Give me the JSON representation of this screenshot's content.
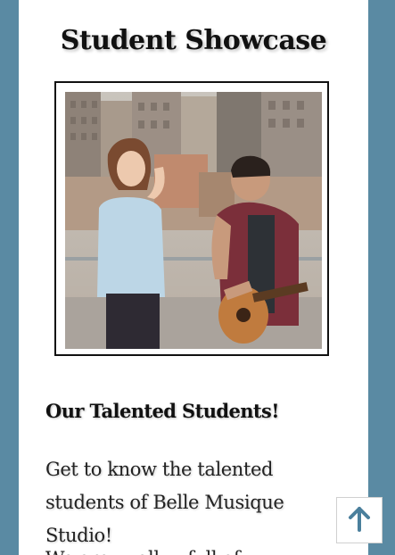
{
  "showcase": {
    "title": "Student Showcase",
    "photo_alt": "Two students performing on a rooftop, one singing and one playing acoustic guitar",
    "subheading": "Our Talented Students!",
    "intro": "Get to know the talented students of Belle Musique Studio!",
    "next_text": "We are ... all ... full of"
  },
  "controls": {
    "back_to_top_icon": "arrow-up-icon"
  },
  "colors": {
    "background": "#5a8aa3",
    "page": "#ffffff",
    "accent": "#4a7f9c",
    "text": "#111111"
  }
}
